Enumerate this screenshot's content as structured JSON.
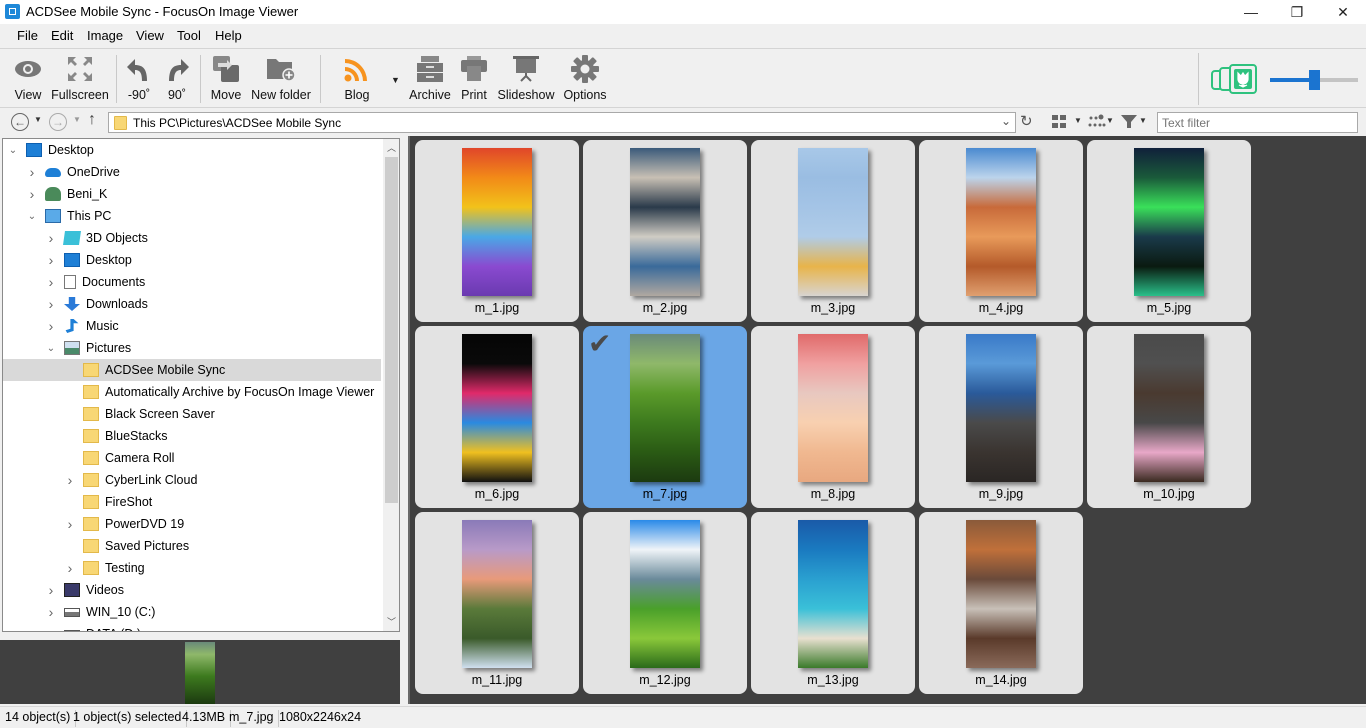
{
  "window": {
    "title": "ACDSee Mobile Sync - FocusOn Image Viewer",
    "minimize_label": "—",
    "restore_label": "❐",
    "close_label": "✕"
  },
  "menu": [
    "File",
    "Edit",
    "Image",
    "View",
    "Tool",
    "Help"
  ],
  "toolbar": {
    "view": "View",
    "fullscreen": "Fullscreen",
    "rotate_left": "-90˚",
    "rotate_right": "90˚",
    "move": "Move",
    "new_folder": "New folder",
    "blog": "Blog",
    "archive": "Archive",
    "print": "Print",
    "slideshow": "Slideshow",
    "options": "Options",
    "thumbnail_size_percent": 50
  },
  "address": {
    "path": "This PC\\Pictures\\ACDSee Mobile Sync",
    "filter_placeholder": "Text filter",
    "filter_value": ""
  },
  "tree": [
    {
      "label": "Desktop",
      "level": 0,
      "expander": "open",
      "icon": "desktop-icon"
    },
    {
      "label": "OneDrive",
      "level": 1,
      "expander": "closed",
      "icon": "onedrive-icon"
    },
    {
      "label": "Beni_K",
      "level": 1,
      "expander": "closed",
      "icon": "user-icon"
    },
    {
      "label": "This PC",
      "level": 1,
      "expander": "open",
      "icon": "computer-icon"
    },
    {
      "label": "3D Objects",
      "level": 2,
      "expander": "closed",
      "icon": "3d-objects-icon"
    },
    {
      "label": "Desktop",
      "level": 2,
      "expander": "closed",
      "icon": "desktop-icon"
    },
    {
      "label": "Documents",
      "level": 2,
      "expander": "closed",
      "icon": "documents-icon"
    },
    {
      "label": "Downloads",
      "level": 2,
      "expander": "closed",
      "icon": "downloads-icon"
    },
    {
      "label": "Music",
      "level": 2,
      "expander": "closed",
      "icon": "music-icon"
    },
    {
      "label": "Pictures",
      "level": 2,
      "expander": "open",
      "icon": "pictures-icon"
    },
    {
      "label": "ACDSee Mobile Sync",
      "level": 3,
      "expander": "none",
      "icon": "folder-icon",
      "selected": true
    },
    {
      "label": "Automatically Archive by FocusOn Image Viewer",
      "level": 3,
      "expander": "none",
      "icon": "folder-icon"
    },
    {
      "label": "Black Screen Saver",
      "level": 3,
      "expander": "none",
      "icon": "folder-icon"
    },
    {
      "label": "BlueStacks",
      "level": 3,
      "expander": "none",
      "icon": "folder-icon"
    },
    {
      "label": "Camera Roll",
      "level": 3,
      "expander": "none",
      "icon": "folder-icon"
    },
    {
      "label": "CyberLink Cloud",
      "level": 3,
      "expander": "closed",
      "icon": "folder-icon"
    },
    {
      "label": "FireShot",
      "level": 3,
      "expander": "none",
      "icon": "folder-icon"
    },
    {
      "label": "PowerDVD 19",
      "level": 3,
      "expander": "closed",
      "icon": "folder-icon"
    },
    {
      "label": "Saved Pictures",
      "level": 3,
      "expander": "none",
      "icon": "folder-icon"
    },
    {
      "label": "Testing",
      "level": 3,
      "expander": "closed",
      "icon": "folder-icon"
    },
    {
      "label": "Videos",
      "level": 2,
      "expander": "closed",
      "icon": "videos-icon"
    },
    {
      "label": "WIN_10 (C:)",
      "level": 2,
      "expander": "closed",
      "icon": "drive-icon"
    },
    {
      "label": "DATA (D:)",
      "level": 2,
      "expander": "closed",
      "icon": "drive-icon"
    }
  ],
  "images": [
    {
      "name": "m_1.jpg",
      "colors": [
        "#e0462a",
        "#f28a18",
        "#f2c21a",
        "#4aa8e6",
        "#8a4ad0",
        "#6a3ab0"
      ]
    },
    {
      "name": "m_2.jpg",
      "colors": [
        "#3a5a7a",
        "#c8c0b4",
        "#2a3a4a",
        "#d0ccc4",
        "#3a6a9a",
        "#b0a8a0"
      ]
    },
    {
      "name": "m_3.jpg",
      "colors": [
        "#a8c8e8",
        "#9abde2",
        "#a4c4e6",
        "#b0cce8",
        "#e8b44a",
        "#d8d4d0"
      ]
    },
    {
      "name": "m_4.jpg",
      "colors": [
        "#4a8ad0",
        "#bcd4ec",
        "#c86a3a",
        "#e89a5a",
        "#b45a2a",
        "#e0a070"
      ]
    },
    {
      "name": "m_5.jpg",
      "colors": [
        "#10203a",
        "#1a5a3a",
        "#3ae05a",
        "#1a3a4a",
        "#0a1a10",
        "#2ac08a"
      ]
    },
    {
      "name": "m_6.jpg",
      "colors": [
        "#050505",
        "#0a0a0a",
        "#e02a6a",
        "#2a8ae0",
        "#f0c020",
        "#101010"
      ]
    },
    {
      "name": "m_7.jpg",
      "colors": [
        "#6a8a7a",
        "#8fb86a",
        "#5a9a2a",
        "#3d7a1e",
        "#2a5a14",
        "#1c3a10"
      ]
    },
    {
      "name": "m_8.jpg",
      "colors": [
        "#e06a6a",
        "#f0a0a0",
        "#e8c8c0",
        "#f8d0b0",
        "#f0b890",
        "#e8a880"
      ]
    },
    {
      "name": "m_9.jpg",
      "colors": [
        "#3a7ac8",
        "#5a9ad8",
        "#2a5a9a",
        "#4a4a4a",
        "#3a3430",
        "#2a2624"
      ]
    },
    {
      "name": "m_10.jpg",
      "colors": [
        "#4a4a4a",
        "#505050",
        "#4a3a30",
        "#484848",
        "#e8a8c8",
        "#3a2a20"
      ]
    },
    {
      "name": "m_11.jpg",
      "colors": [
        "#8a7ab8",
        "#b89ac8",
        "#e89a7a",
        "#5a7a3a",
        "#3a5a2a",
        "#d0e0f0"
      ]
    },
    {
      "name": "m_12.jpg",
      "colors": [
        "#2a8ae8",
        "#f0f4f8",
        "#6a8a9a",
        "#4aa02a",
        "#8ac83a",
        "#2a6a1a"
      ]
    },
    {
      "name": "m_13.jpg",
      "colors": [
        "#1a5aa8",
        "#1a7ac0",
        "#2aa0d0",
        "#3ac0d8",
        "#e8e0d0",
        "#3a7a2a"
      ]
    },
    {
      "name": "m_14.jpg",
      "colors": [
        "#8a5a3a",
        "#c0703a",
        "#6a4a3a",
        "#c8c0b8",
        "#5a3a2a",
        "#8a6a5a"
      ]
    }
  ],
  "selected_index": 6,
  "status": {
    "count": "14 object(s)",
    "selected": "1 object(s) selected",
    "size": "4.13MB",
    "filename": "m_7.jpg",
    "dimensions": "1080x2246x24"
  }
}
